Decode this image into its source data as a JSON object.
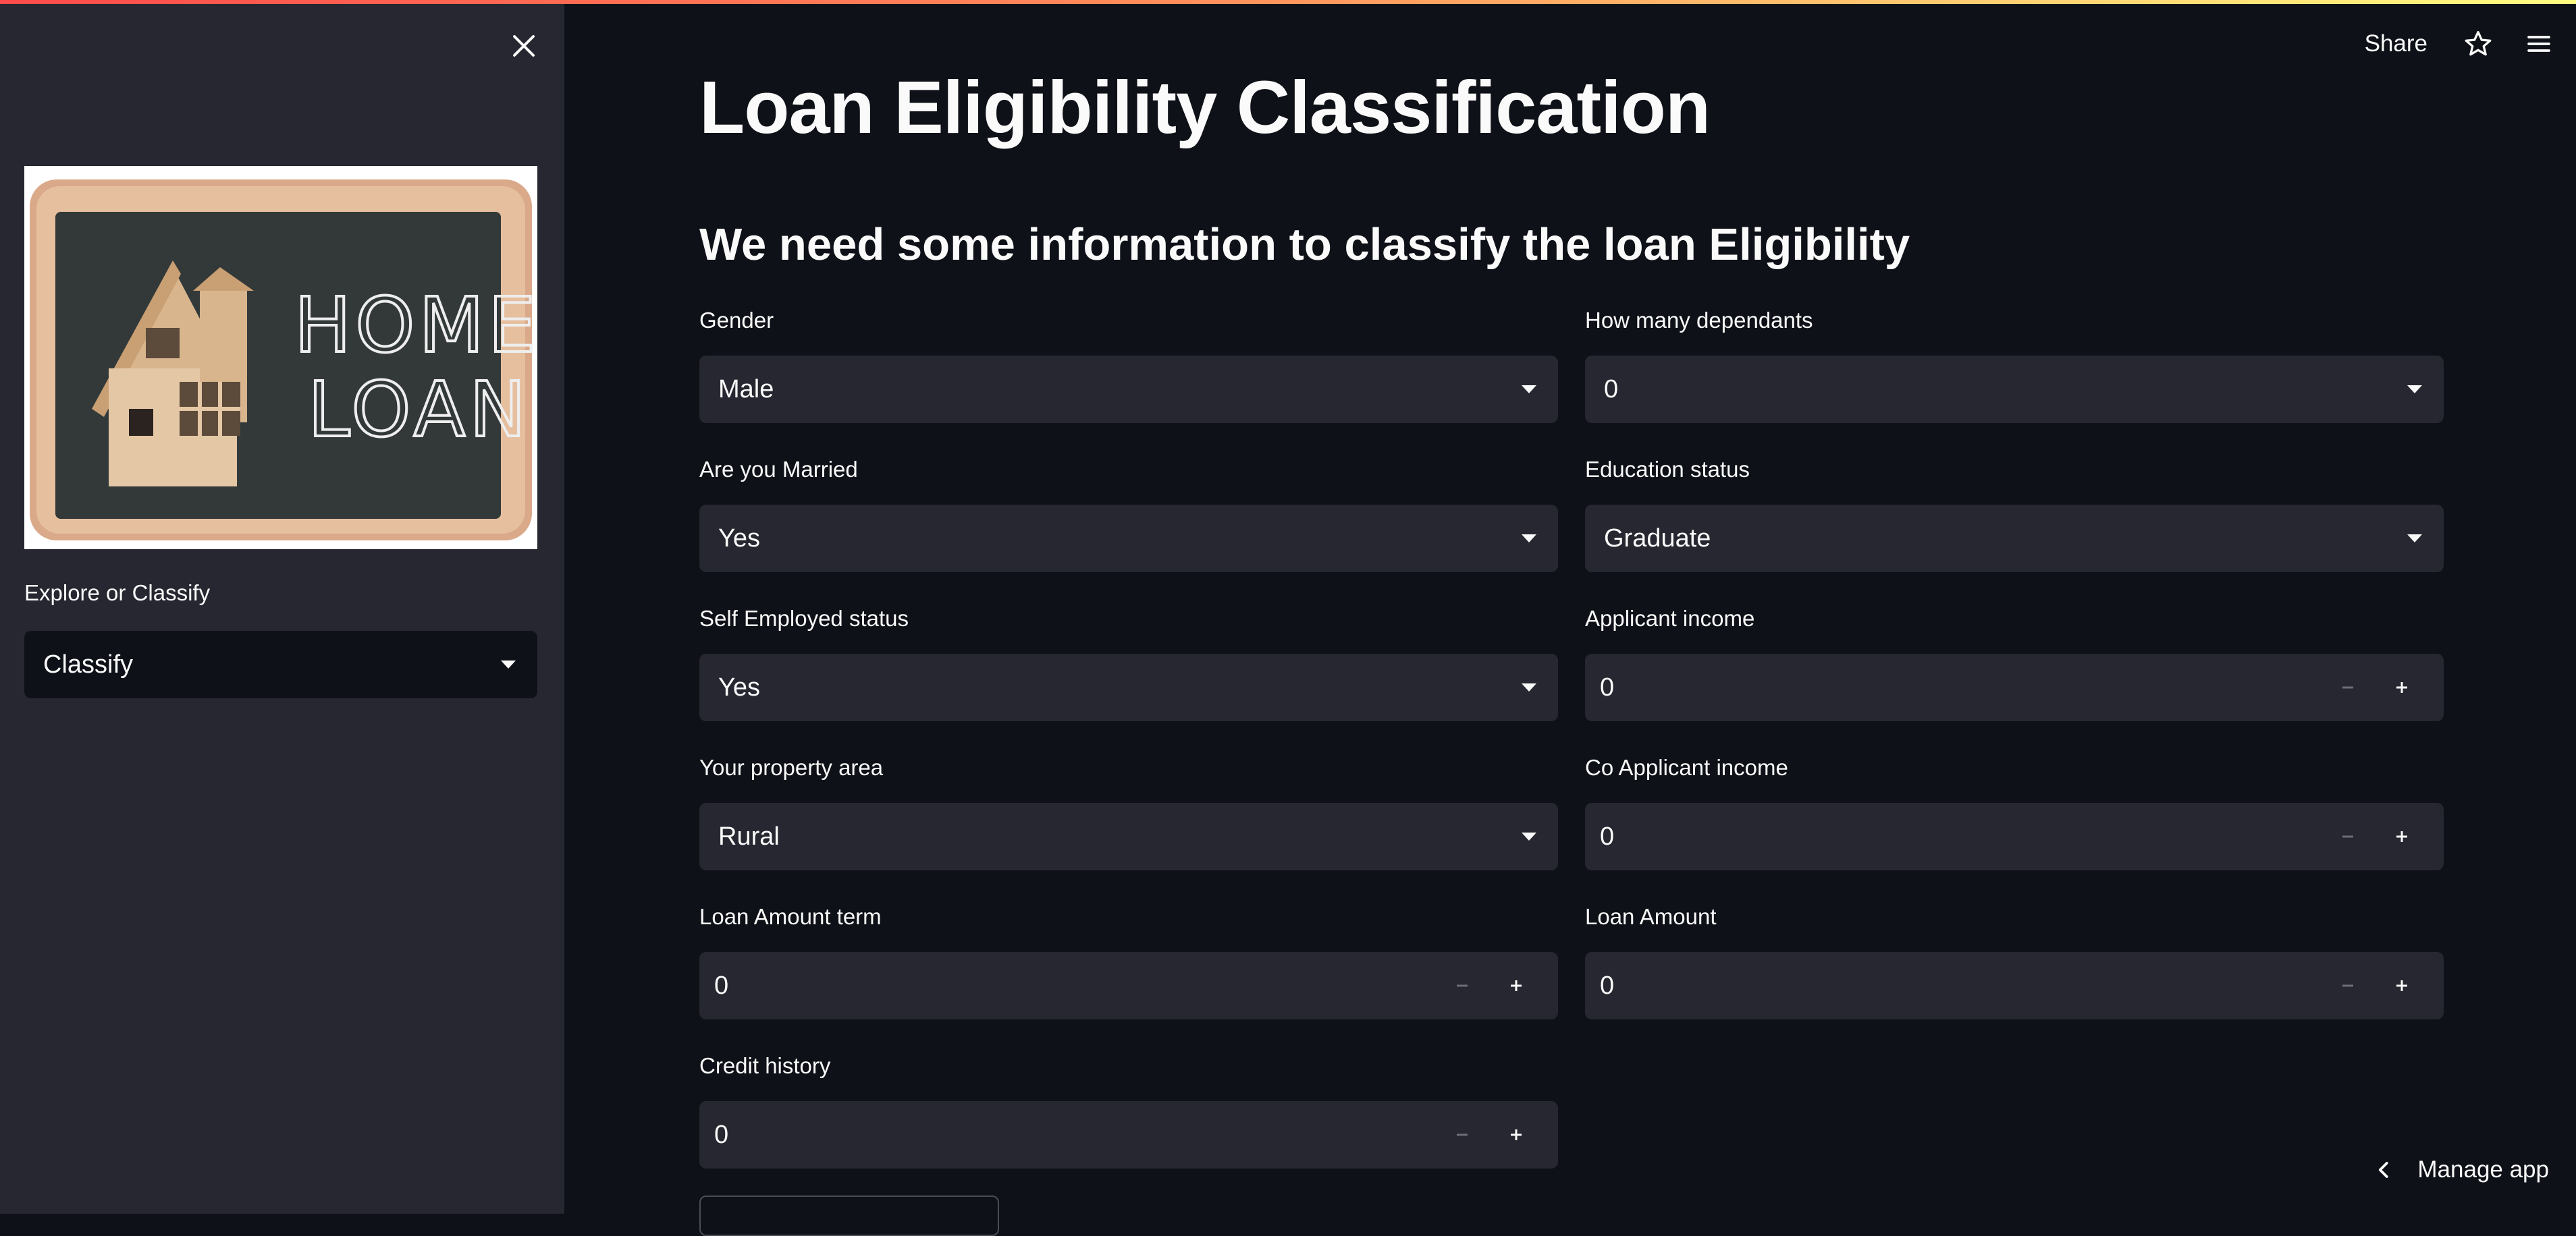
{
  "header": {
    "share_label": "Share",
    "manage_app_label": "Manage app"
  },
  "sidebar": {
    "image_text_line1": "HOME",
    "image_text_line2": "LOAN",
    "select_label": "Explore or Classify",
    "select_value": "Classify"
  },
  "main": {
    "title": "Loan Eligibility Classification",
    "subtitle": "We need some information to classify the loan Eligibility",
    "fields": {
      "gender": {
        "label": "Gender",
        "value": "Male"
      },
      "dependants": {
        "label": "How many dependants",
        "value": "0"
      },
      "married": {
        "label": "Are you Married",
        "value": "Yes"
      },
      "education": {
        "label": "Education status",
        "value": "Graduate"
      },
      "self_employed": {
        "label": "Self Employed status",
        "value": "Yes"
      },
      "applicant_income": {
        "label": "Applicant income",
        "value": "0"
      },
      "property_area": {
        "label": "Your property area",
        "value": "Rural"
      },
      "coapplicant_income": {
        "label": "Co Applicant income",
        "value": "0"
      },
      "loan_amount_term": {
        "label": "Loan Amount term",
        "value": "0"
      },
      "loan_amount": {
        "label": "Loan Amount",
        "value": "0"
      },
      "credit_history": {
        "label": "Credit history",
        "value": "0"
      }
    }
  },
  "colors": {
    "app_background": "#0e1117",
    "sidebar_background": "#262730",
    "widget_background": "#262730",
    "text": "#fafafa",
    "accent_red": "#ff4b4b"
  },
  "icons": {
    "close": "close-icon",
    "star": "star-icon",
    "menu": "hamburger-menu-icon",
    "caret": "caret-down-icon",
    "minus": "minus-icon",
    "plus": "plus-icon",
    "chevron": "chevron-left-icon"
  }
}
